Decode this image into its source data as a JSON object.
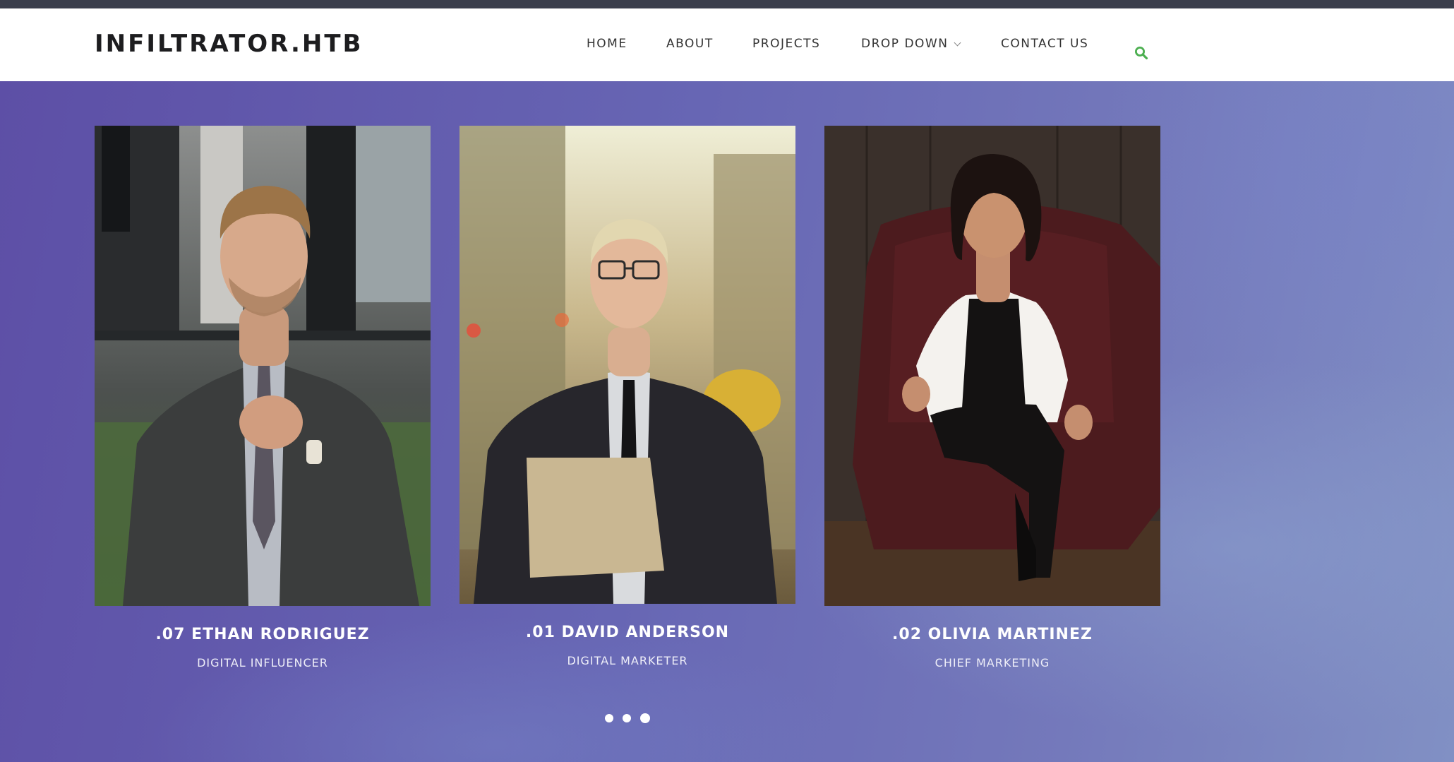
{
  "brand": {
    "logo": "INFILTRATOR.HTB"
  },
  "nav": {
    "items": [
      {
        "label": "HOME"
      },
      {
        "label": "ABOUT"
      },
      {
        "label": "PROJECTS"
      },
      {
        "label": "DROP DOWN",
        "has_dropdown": true
      },
      {
        "label": "CONTACT US"
      }
    ],
    "search_icon": "search-icon",
    "search_icon_color": "#4caf50"
  },
  "team": [
    {
      "name": ".07 ETHAN RODRIGUEZ",
      "role": "DIGITAL INFLUENCER"
    },
    {
      "name": ".01 DAVID ANDERSON",
      "role": "DIGITAL MARKETER"
    },
    {
      "name": ".02 OLIVIA MARTINEZ",
      "role": "CHIEF MARKETING"
    }
  ],
  "carousel": {
    "dot_count": 3,
    "active_index": 2
  }
}
